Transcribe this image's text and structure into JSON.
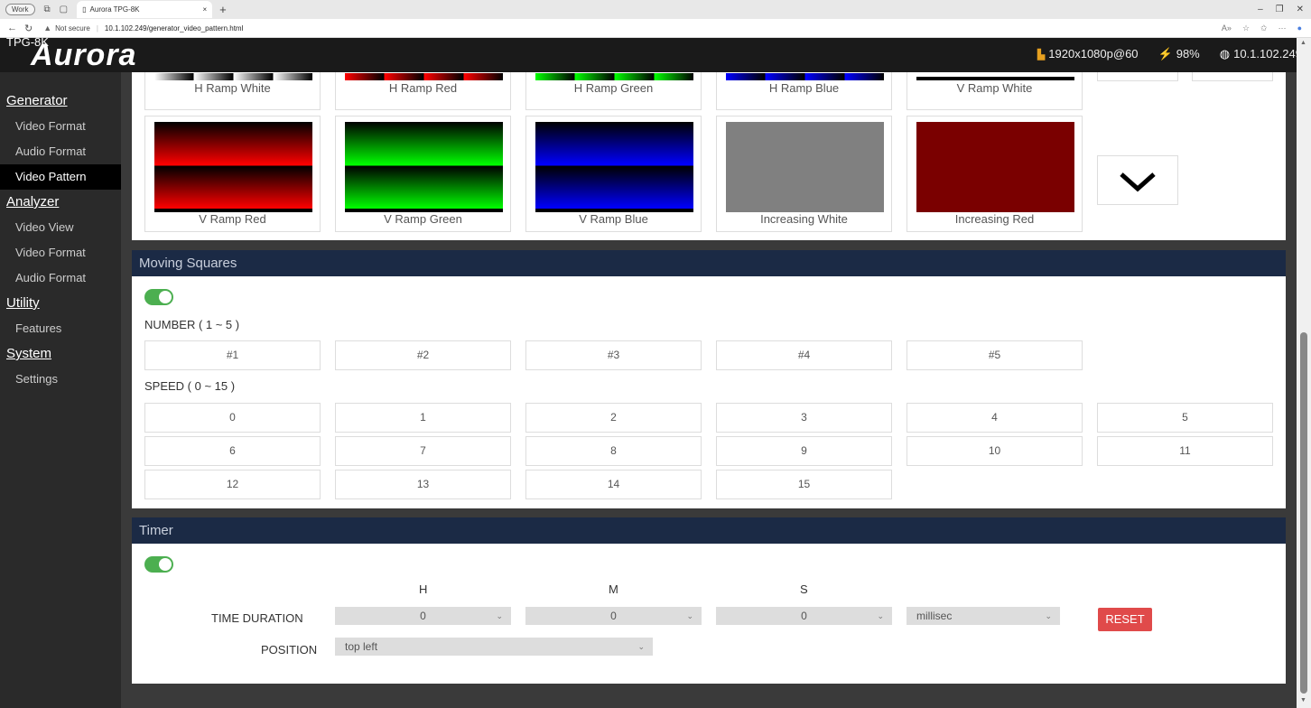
{
  "browser": {
    "profile": "Work",
    "tab_title": "Aurora TPG-8K",
    "tab_close": "×",
    "new_tab": "+",
    "security": "Not secure",
    "url": "10.1.102.249/generator_video_pattern.html"
  },
  "app": {
    "logo": "Aurora",
    "model": "TPG-8K",
    "status": {
      "resolution": "1920x1080p@60",
      "power": "98%",
      "ip": "10.1.102.249"
    }
  },
  "sidebar": {
    "sections": [
      {
        "label": "Generator",
        "items": [
          "Video Format",
          "Audio Format",
          "Video Pattern"
        ]
      },
      {
        "label": "Analyzer",
        "items": [
          "Video View",
          "Video Format",
          "Audio Format"
        ]
      },
      {
        "label": "Utility",
        "items": [
          "Features"
        ]
      },
      {
        "label": "System",
        "items": [
          "Settings"
        ]
      }
    ],
    "active_item": "Video Pattern"
  },
  "patterns": {
    "row1": [
      "H Ramp White",
      "H Ramp Red",
      "H Ramp Green",
      "H Ramp Blue",
      "V Ramp White"
    ],
    "row2": [
      "V Ramp Red",
      "V Ramp Green",
      "V Ramp Blue",
      "Increasing White",
      "Increasing Red"
    ]
  },
  "moving_squares": {
    "title": "Moving Squares",
    "enabled": true,
    "number_label": "NUMBER ( 1 ~ 5 )",
    "numbers": [
      "#1",
      "#2",
      "#3",
      "#4",
      "#5"
    ],
    "speed_label": "SPEED ( 0 ~ 15 )",
    "speeds": [
      "0",
      "1",
      "2",
      "3",
      "4",
      "5",
      "6",
      "7",
      "8",
      "9",
      "10",
      "11",
      "12",
      "13",
      "14",
      "15"
    ]
  },
  "timer": {
    "title": "Timer",
    "enabled": true,
    "col_h": "H",
    "col_m": "M",
    "col_s": "S",
    "duration_label": "TIME DURATION",
    "h_value": "0",
    "m_value": "0",
    "s_value": "0",
    "ms_value": "millisec",
    "reset_label": "RESET",
    "position_label": "POSITION",
    "position_value": "top left"
  }
}
